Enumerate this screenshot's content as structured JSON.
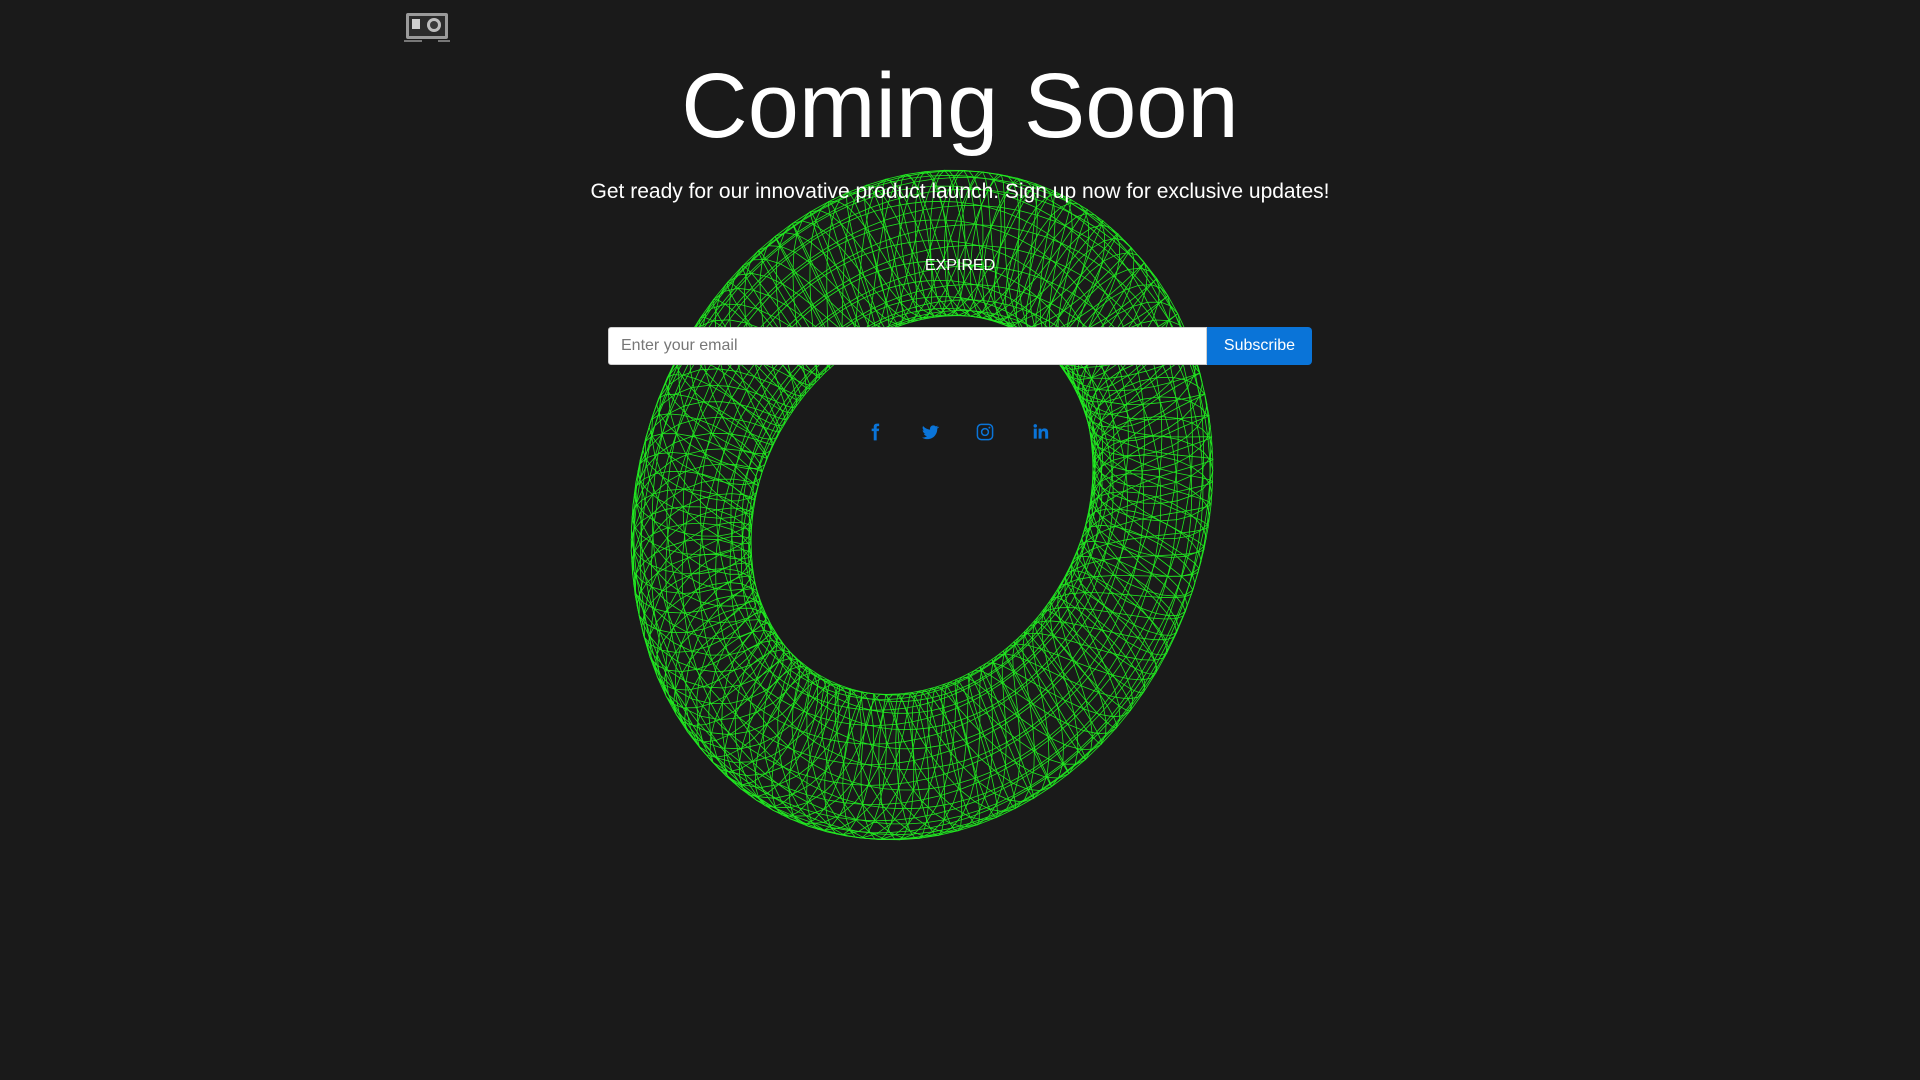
{
  "header": {
    "logo_icon": "camera-logo-icon"
  },
  "hero": {
    "title": "Coming Soon",
    "subtitle": "Get ready for our innovative product launch. Sign up now for exclusive updates!",
    "countdown_status": "EXPIRED"
  },
  "signup": {
    "email_placeholder": "Enter your email",
    "email_value": "",
    "subscribe_label": "Subscribe"
  },
  "social": {
    "icons": [
      "facebook-icon",
      "twitter-icon",
      "instagram-icon",
      "linkedin-icon"
    ]
  },
  "colors": {
    "background": "#1a1a1a",
    "accent": "#0a74d8",
    "wireframe": "#22ff22",
    "text": "#ffffff"
  }
}
